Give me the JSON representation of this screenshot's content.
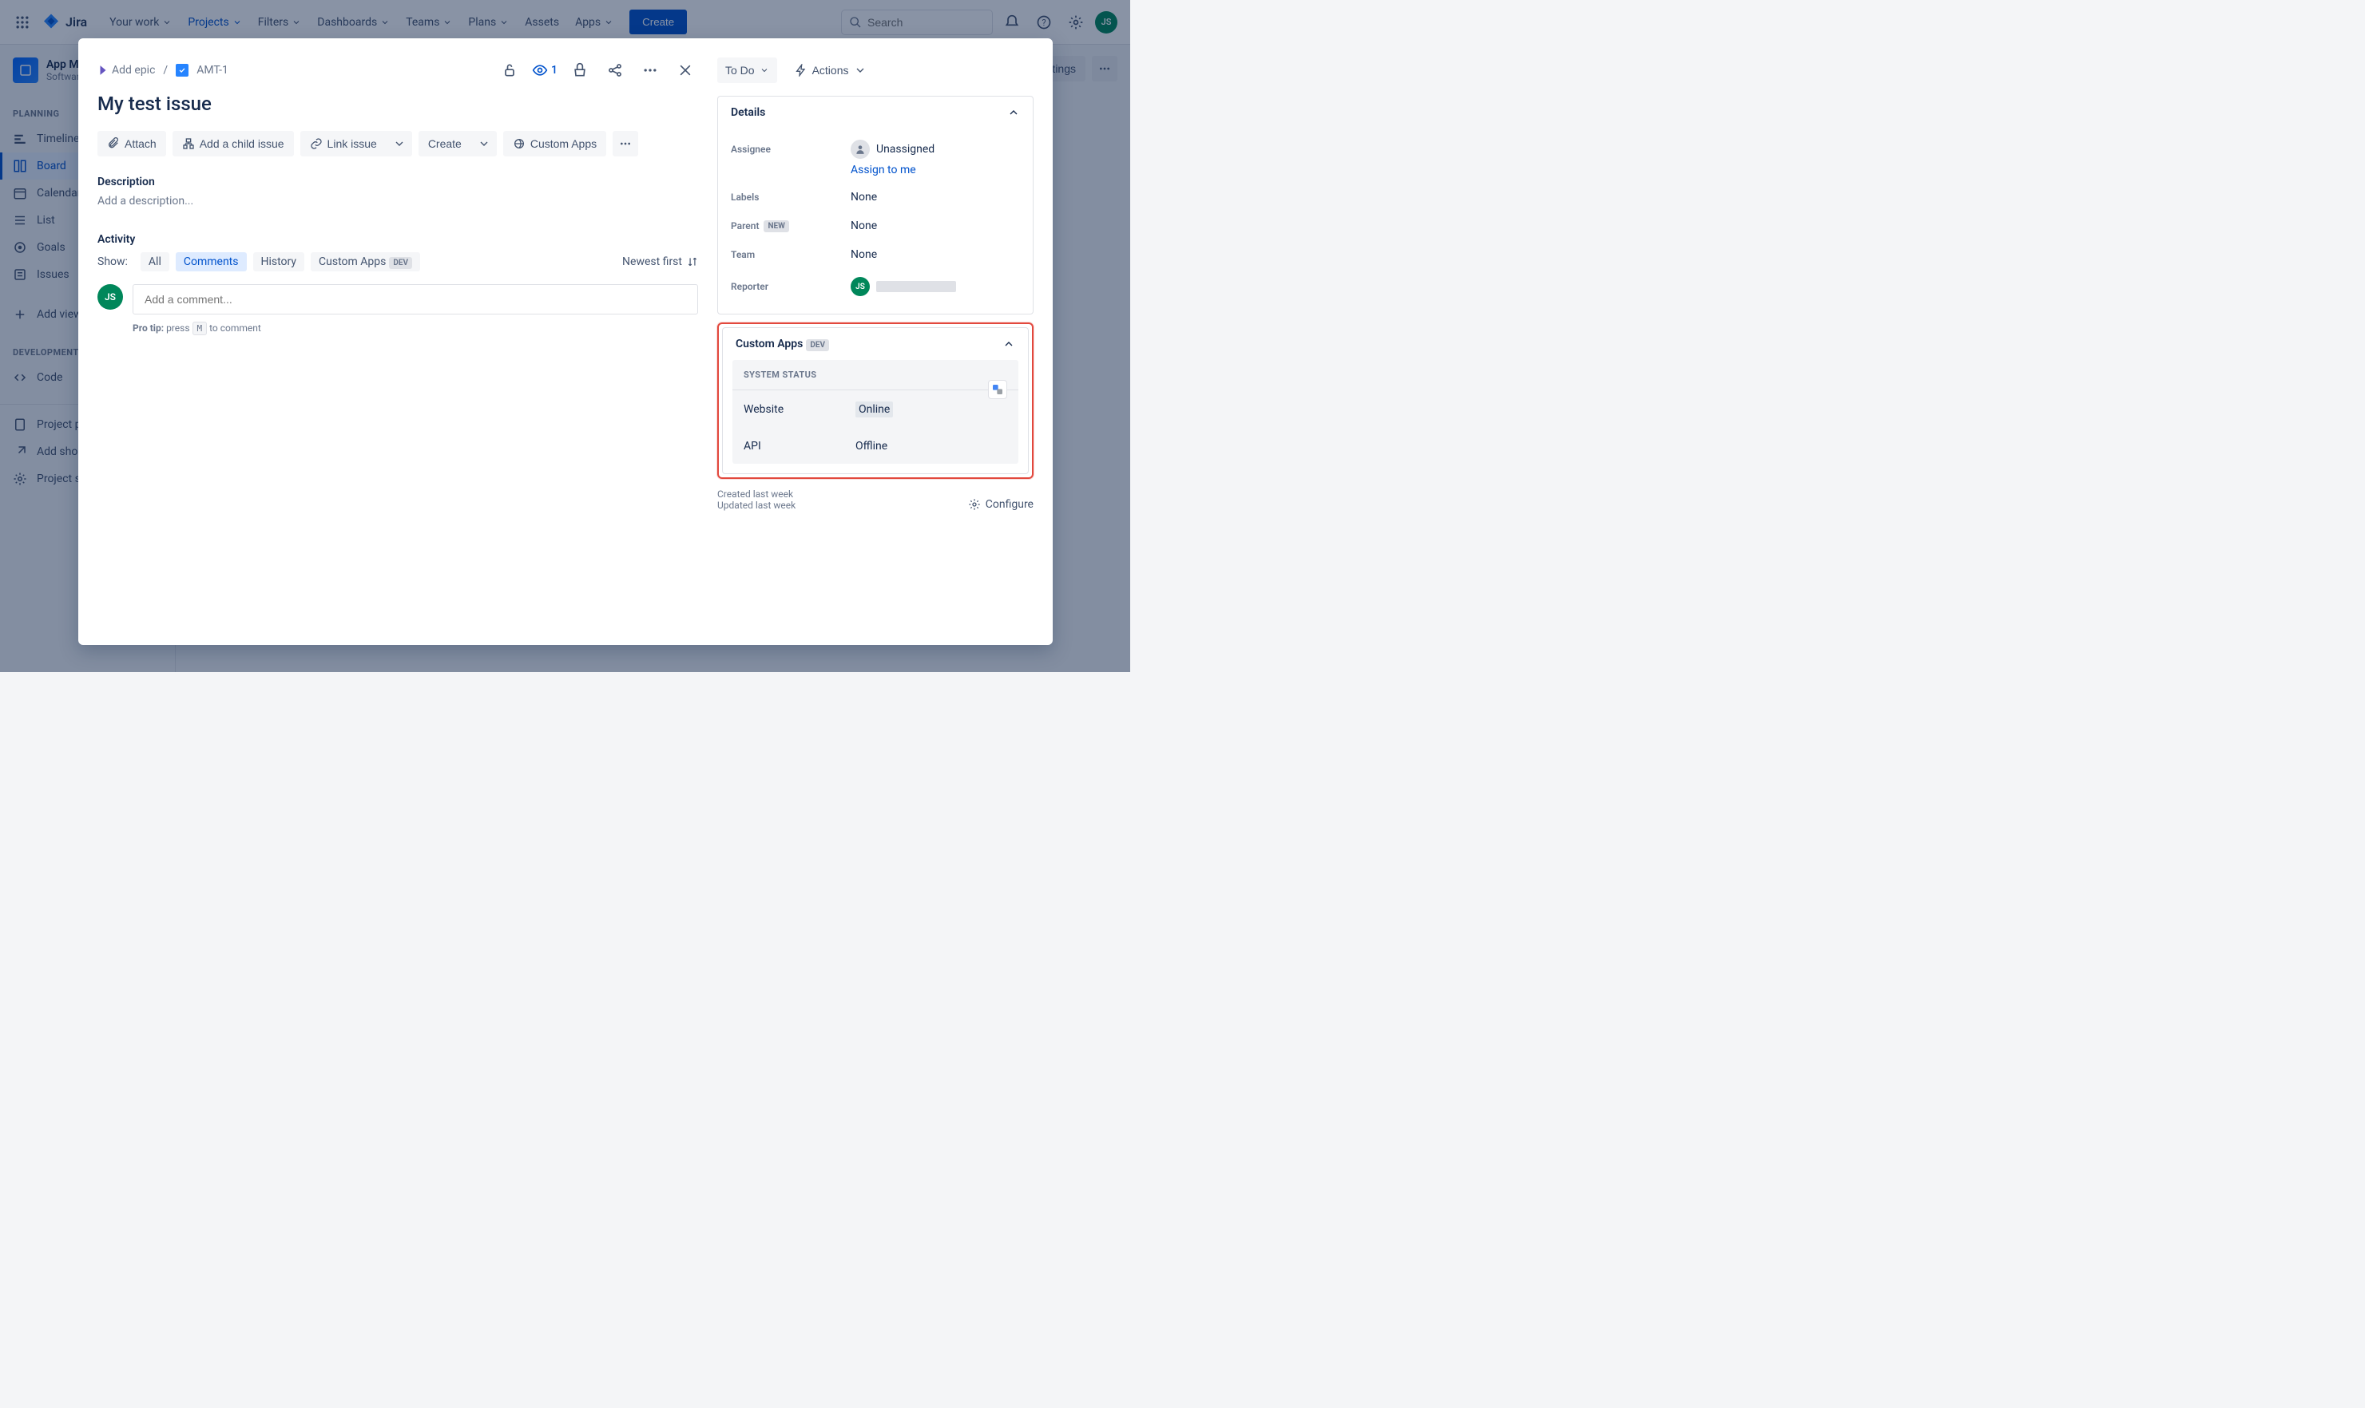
{
  "topbar": {
    "logo_text": "Jira",
    "nav": [
      {
        "label": "Your work",
        "has_dropdown": true
      },
      {
        "label": "Projects",
        "has_dropdown": true,
        "active": true
      },
      {
        "label": "Filters",
        "has_dropdown": true
      },
      {
        "label": "Dashboards",
        "has_dropdown": true
      },
      {
        "label": "Teams",
        "has_dropdown": true
      },
      {
        "label": "Plans",
        "has_dropdown": true
      },
      {
        "label": "Assets",
        "has_dropdown": false
      },
      {
        "label": "Apps",
        "has_dropdown": true
      }
    ],
    "create_label": "Create",
    "search_placeholder": "Search",
    "avatar_initials": "JS"
  },
  "sidebar": {
    "project_name": "App Mak…",
    "project_type": "Software p…",
    "sections": [
      {
        "heading": "PLANNING",
        "items": [
          {
            "label": "Timeline",
            "icon": "timeline"
          },
          {
            "label": "Board",
            "icon": "board",
            "active": true
          },
          {
            "label": "Calendar",
            "icon": "calendar"
          },
          {
            "label": "List",
            "icon": "list"
          },
          {
            "label": "Goals",
            "icon": "goals"
          },
          {
            "label": "Issues",
            "icon": "issues"
          }
        ]
      },
      {
        "heading": "",
        "items": [
          {
            "label": "Add view",
            "icon": "add"
          }
        ]
      },
      {
        "heading": "DEVELOPMENT",
        "items": [
          {
            "label": "Code",
            "icon": "code"
          }
        ]
      },
      {
        "heading": "",
        "items": [
          {
            "label": "Project p…",
            "icon": "page"
          },
          {
            "label": "Add sho…",
            "icon": "shortcut"
          },
          {
            "label": "Project s…",
            "icon": "settings"
          }
        ]
      }
    ]
  },
  "right_controls": {
    "settings_label": "w settings"
  },
  "modal": {
    "add_epic_label": "Add epic",
    "issue_key": "AMT-1",
    "watch_count": "1",
    "title": "My test issue",
    "actions": {
      "attach": "Attach",
      "add_child": "Add a child issue",
      "link_issue": "Link issue",
      "create": "Create",
      "custom_apps": "Custom Apps"
    },
    "description_heading": "Description",
    "description_placeholder": "Add a description...",
    "activity_heading": "Activity",
    "show_label": "Show:",
    "tabs": {
      "all": "All",
      "comments": "Comments",
      "history": "History",
      "custom_apps": "Custom Apps",
      "dev_badge": "DEV"
    },
    "sort_label": "Newest first",
    "comment_placeholder": "Add a comment...",
    "protip_pre": "Pro tip: ",
    "protip_press": "press",
    "protip_key": "M",
    "protip_post": "to comment",
    "avatar_initials": "JS"
  },
  "right_panel": {
    "status_label": "To Do",
    "actions_label": "Actions",
    "details_heading": "Details",
    "fields": {
      "assignee_label": "Assignee",
      "assignee_value": "Unassigned",
      "assign_to_me": "Assign to me",
      "labels_label": "Labels",
      "labels_value": "None",
      "parent_label": "Parent",
      "parent_badge": "NEW",
      "parent_value": "None",
      "team_label": "Team",
      "team_value": "None",
      "reporter_label": "Reporter"
    },
    "custom_apps": {
      "heading": "Custom Apps",
      "dev_badge": "DEV",
      "card_heading": "SYSTEM STATUS",
      "website_label": "Website",
      "website_value": "Online",
      "api_label": "API",
      "api_value": "Offline"
    },
    "created": "Created last week",
    "updated": "Updated last week",
    "configure": "Configure"
  }
}
